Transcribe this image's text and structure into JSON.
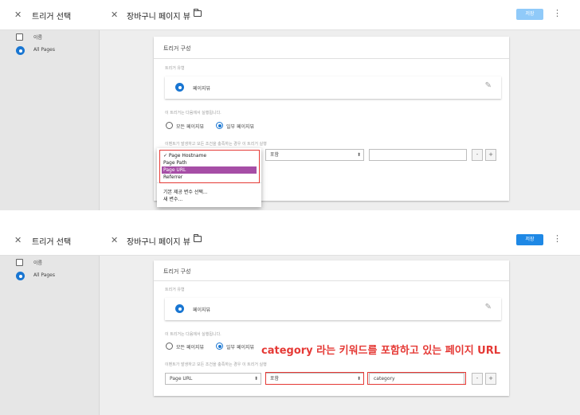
{
  "header": {
    "side_title": "트리거 선택",
    "main_title": "장바구니 페이지 뷰",
    "save_label": "저장",
    "close_glyph": "✕",
    "more_glyph": "⋮"
  },
  "sidebar": {
    "items": [
      {
        "label": "이름",
        "icon": "checkbox-icon"
      },
      {
        "label": "All Pages",
        "icon": "eye-icon"
      }
    ]
  },
  "card": {
    "title": "트리거 구성",
    "type_label": "트리거 유형",
    "type_value": "페이지뷰",
    "fires_on_label": "이 트리거는 다음에서 실행됩니다.",
    "option_all": "모든 페이지뷰",
    "option_some": "일부 페이지뷰",
    "condition_label": "이벤트가 발생하고 모든 조건을 충족하는 경우 이 트리거 실행",
    "operator": "포함",
    "plus": "+",
    "minus": "-"
  },
  "panel1": {
    "variable_menu": {
      "items": [
        "✓ Page Hostname",
        "Page Path",
        "Page URL",
        "Referrer"
      ],
      "highlighted_index": 2,
      "extra_items": [
        "기본 제공 변수 선택...",
        "새 변수..."
      ]
    },
    "value": ""
  },
  "panel2": {
    "variable": "Page URL",
    "value": "category",
    "annotation": "category 라는 키워드를 포함하고 있는 페이지 URL"
  },
  "colors": {
    "accent_blue": "#1976d2",
    "save_disabled": "#90caf9",
    "save_enabled": "#1e88e5",
    "highlight": "#a64ea6",
    "annotation_red": "#e53935"
  }
}
